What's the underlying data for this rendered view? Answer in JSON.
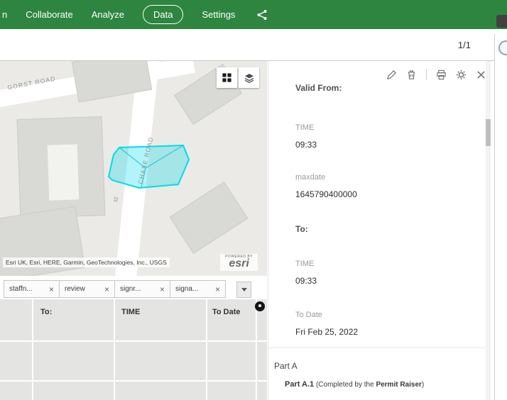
{
  "colors": {
    "brand_green": "#2e8540",
    "highlight_cyan": "#00dce8"
  },
  "nav": {
    "item_partial": "n",
    "item_collaborate": "Collaborate",
    "item_analyze": "Analyze",
    "item_data": "Data",
    "item_settings": "Settings"
  },
  "header": {
    "page_indicator": "1/1"
  },
  "map": {
    "road_label_1": "GORST ROAD",
    "road_label_2": "CHASE ROAD",
    "road_number": "32",
    "attribution": "Esri UK, Esri, HERE, Garmin, GeoTechnologies, Inc., USGS",
    "powered_by": "POWERED BY",
    "logo_text": "esri"
  },
  "tabs": {
    "tab_1": "staffn...",
    "tab_2": "review",
    "tab_3": "signr...",
    "tab_4": "signa...",
    "close_glyph": "×"
  },
  "table": {
    "header_1": "To:",
    "header_2": "TIME",
    "header_3": "To Date"
  },
  "panel": {
    "heading_from": "Valid From:",
    "time_label_1": "TIME",
    "time_value_1": "09:33",
    "maxdate_label": "maxdate",
    "maxdate_value": "1645790400000",
    "heading_to": "To:",
    "time_label_2": "TIME",
    "time_value_2": "09:33",
    "todate_label": "To Date",
    "todate_value": "Fri Feb 25, 2022",
    "section_title": "Part A",
    "subsection_bold": "Part A.1",
    "subsection_text": " (Completed by the ",
    "subsection_bold_2": "Permit Raiser",
    "subsection_close": ")"
  }
}
